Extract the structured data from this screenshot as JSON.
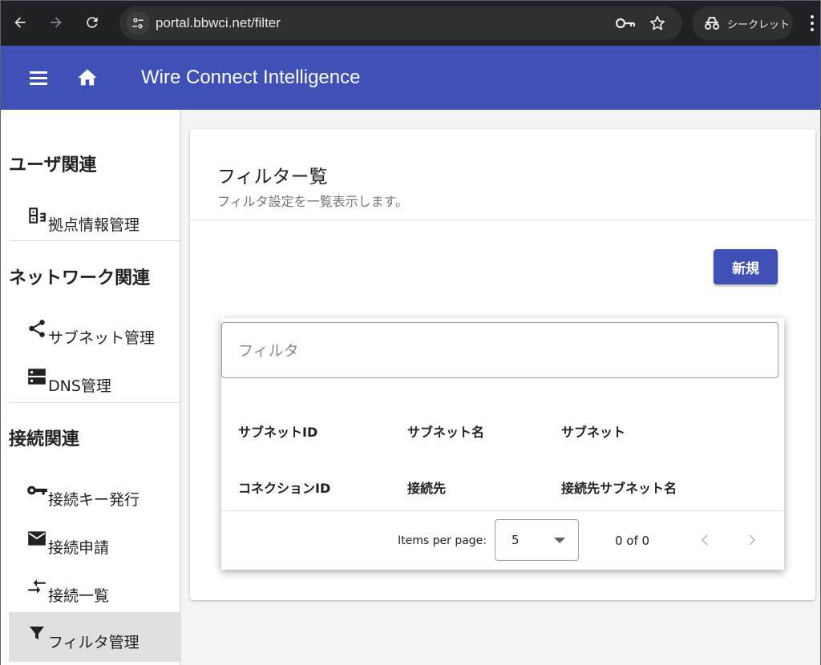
{
  "browser": {
    "url": "portal.bbwci.net/filter",
    "incognito_label": "シークレット"
  },
  "toolbar": {
    "app_title": "Wire Connect Intelligence"
  },
  "sidebar": {
    "sections": [
      {
        "title": "ユーザ関連",
        "items": [
          {
            "label": "拠点情報管理",
            "icon": "business-icon"
          }
        ]
      },
      {
        "title": "ネットワーク関連",
        "items": [
          {
            "label": "サブネット管理",
            "icon": "share-icon"
          },
          {
            "label": "DNS管理",
            "icon": "dns-icon"
          }
        ]
      },
      {
        "title": "接続関連",
        "items": [
          {
            "label": "接続キー発行",
            "icon": "key-icon"
          },
          {
            "label": "接続申請",
            "icon": "mail-icon"
          },
          {
            "label": "接続一覧",
            "icon": "compare-arrows-icon"
          },
          {
            "label": "フィルタ管理",
            "icon": "filter-icon",
            "active": true
          }
        ]
      }
    ]
  },
  "main": {
    "title": "フィルター覧",
    "subtitle": "フィルタ設定を一覧表示します。",
    "new_button": "新規",
    "filter_placeholder": "フィルタ",
    "columns_row1": [
      "サブネットID",
      "サブネット名",
      "サブネット"
    ],
    "columns_row2": [
      "コネクションID",
      "接続先",
      "接続先サブネット名"
    ],
    "paginator": {
      "items_per_page_label": "Items per page:",
      "page_size": "5",
      "range": "0 of 0"
    }
  },
  "colors": {
    "primary": "#3f51b5",
    "chrome_bg": "#202124",
    "active_item_bg": "#e0e0e0"
  }
}
